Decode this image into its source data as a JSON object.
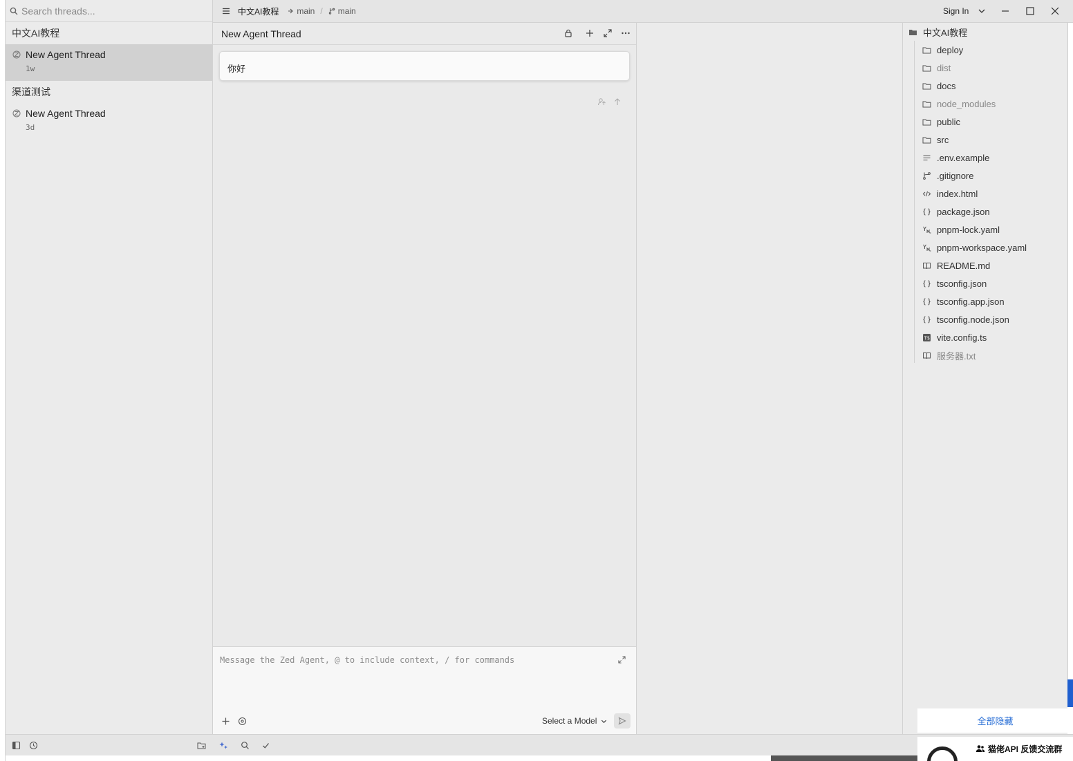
{
  "search": {
    "placeholder": "Search threads..."
  },
  "threads": {
    "groups": [
      {
        "title": "中文AI教程",
        "items": [
          {
            "name": "New Agent Thread",
            "age": "1w"
          }
        ]
      },
      {
        "title": "渠道测试",
        "items": [
          {
            "name": "New Agent Thread",
            "age": "3d"
          }
        ]
      }
    ]
  },
  "titlebar": {
    "project": "中文AI教程",
    "worktree": "main",
    "branch": "main",
    "sign_in": "Sign In"
  },
  "agent": {
    "title": "New Agent Thread",
    "message": "你好",
    "composer_placeholder": "Message the Zed Agent, @ to include context, / for commands",
    "model_label": "Select a Model"
  },
  "project": {
    "root": "中文AI教程",
    "entries": [
      {
        "name": "deploy",
        "icon": "folder-icon",
        "dim": false
      },
      {
        "name": "dist",
        "icon": "folder-icon",
        "dim": true
      },
      {
        "name": "docs",
        "icon": "folder-icon",
        "dim": false
      },
      {
        "name": "node_modules",
        "icon": "folder-icon",
        "dim": true
      },
      {
        "name": "public",
        "icon": "folder-icon",
        "dim": false
      },
      {
        "name": "src",
        "icon": "folder-icon",
        "dim": false
      },
      {
        "name": ".env.example",
        "icon": "lines-icon",
        "dim": false
      },
      {
        "name": ".gitignore",
        "icon": "git-icon",
        "dim": false
      },
      {
        "name": "index.html",
        "icon": "code-icon",
        "dim": false
      },
      {
        "name": "package.json",
        "icon": "braces-icon",
        "dim": false
      },
      {
        "name": "pnpm-lock.yaml",
        "icon": "yaml-icon",
        "dim": false
      },
      {
        "name": "pnpm-workspace.yaml",
        "icon": "yaml-icon",
        "dim": false
      },
      {
        "name": "README.md",
        "icon": "book-icon",
        "dim": false
      },
      {
        "name": "tsconfig.json",
        "icon": "braces-icon",
        "dim": false
      },
      {
        "name": "tsconfig.app.json",
        "icon": "braces-icon",
        "dim": false
      },
      {
        "name": "tsconfig.node.json",
        "icon": "braces-icon",
        "dim": false
      },
      {
        "name": "vite.config.ts",
        "icon": "ts-icon",
        "dim": false
      },
      {
        "name": "服务器.txt",
        "icon": "book-icon",
        "dim": true
      }
    ]
  },
  "overlay": {
    "hide_all": "全部隐藏",
    "group_chat": "猫佬API 反馈交流群"
  },
  "colors": {
    "link": "#2a6fd6",
    "active_thread": "#d1d1d1",
    "panel": "#ebebeb"
  }
}
